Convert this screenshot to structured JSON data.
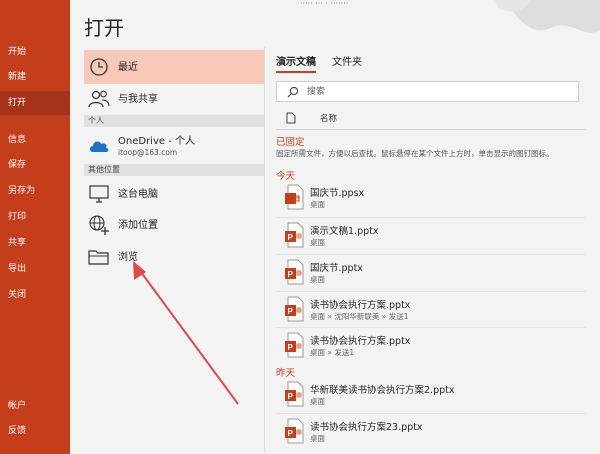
{
  "window": {
    "top_strip_text": "·····  ···  ·  ·······"
  },
  "rail": {
    "items": [
      {
        "label": "开始"
      },
      {
        "label": "新建"
      },
      {
        "label": "打开"
      },
      {
        "label": "信息"
      },
      {
        "label": "保存"
      },
      {
        "label": "另存为"
      },
      {
        "label": "打印"
      },
      {
        "label": "共享"
      },
      {
        "label": "导出"
      },
      {
        "label": "关闭"
      },
      {
        "label": "帐户"
      },
      {
        "label": "反馈"
      }
    ]
  },
  "page": {
    "title": "打开"
  },
  "locations": {
    "recent": "最近",
    "shared": "与我共享",
    "personal_header": "个人",
    "onedrive": {
      "name": "OneDrive - 个人",
      "account": "itoop@163.com"
    },
    "other_header": "其他位置",
    "this_pc": "这台电脑",
    "add_place": "添加位置",
    "browse": "浏览"
  },
  "files": {
    "tabs": [
      "演示文稿",
      "文件夹"
    ],
    "search_placeholder": "搜索",
    "column_name": "名称",
    "pinned_label": "已固定",
    "pinned_note": "固定所需文件，方便以后查找。鼠标悬停在某个文件上方时，单击显示的图钉图标。",
    "today_label": "今天",
    "yesterday_label": "昨天",
    "today": [
      {
        "name": "国庆节.ppsx",
        "location": "桌面",
        "type": "ppsx"
      },
      {
        "name": "演示文稿1.pptx",
        "location": "桌面",
        "type": "pptx"
      },
      {
        "name": "国庆节.pptx",
        "location": "桌面",
        "type": "pptx"
      },
      {
        "name": "读书协会执行方案.pptx",
        "location": "桌面 » 沈阳华新联美 » 发送1",
        "type": "pptx"
      },
      {
        "name": "读书协会执行方案.pptx",
        "location": "桌面 » 发送1",
        "type": "pptx"
      }
    ],
    "yesterday": [
      {
        "name": "华新联美读书协会执行方案2.pptx",
        "location": "桌面",
        "type": "pptx"
      },
      {
        "name": "读书协会执行方案23.pptx",
        "location": "桌面",
        "type": "pptx"
      }
    ]
  },
  "colors": {
    "accent": "#c43e1c",
    "rail_active": "#a5321a",
    "selected_location": "#f8c9b8",
    "annotation_arrow": "#e0484a"
  }
}
